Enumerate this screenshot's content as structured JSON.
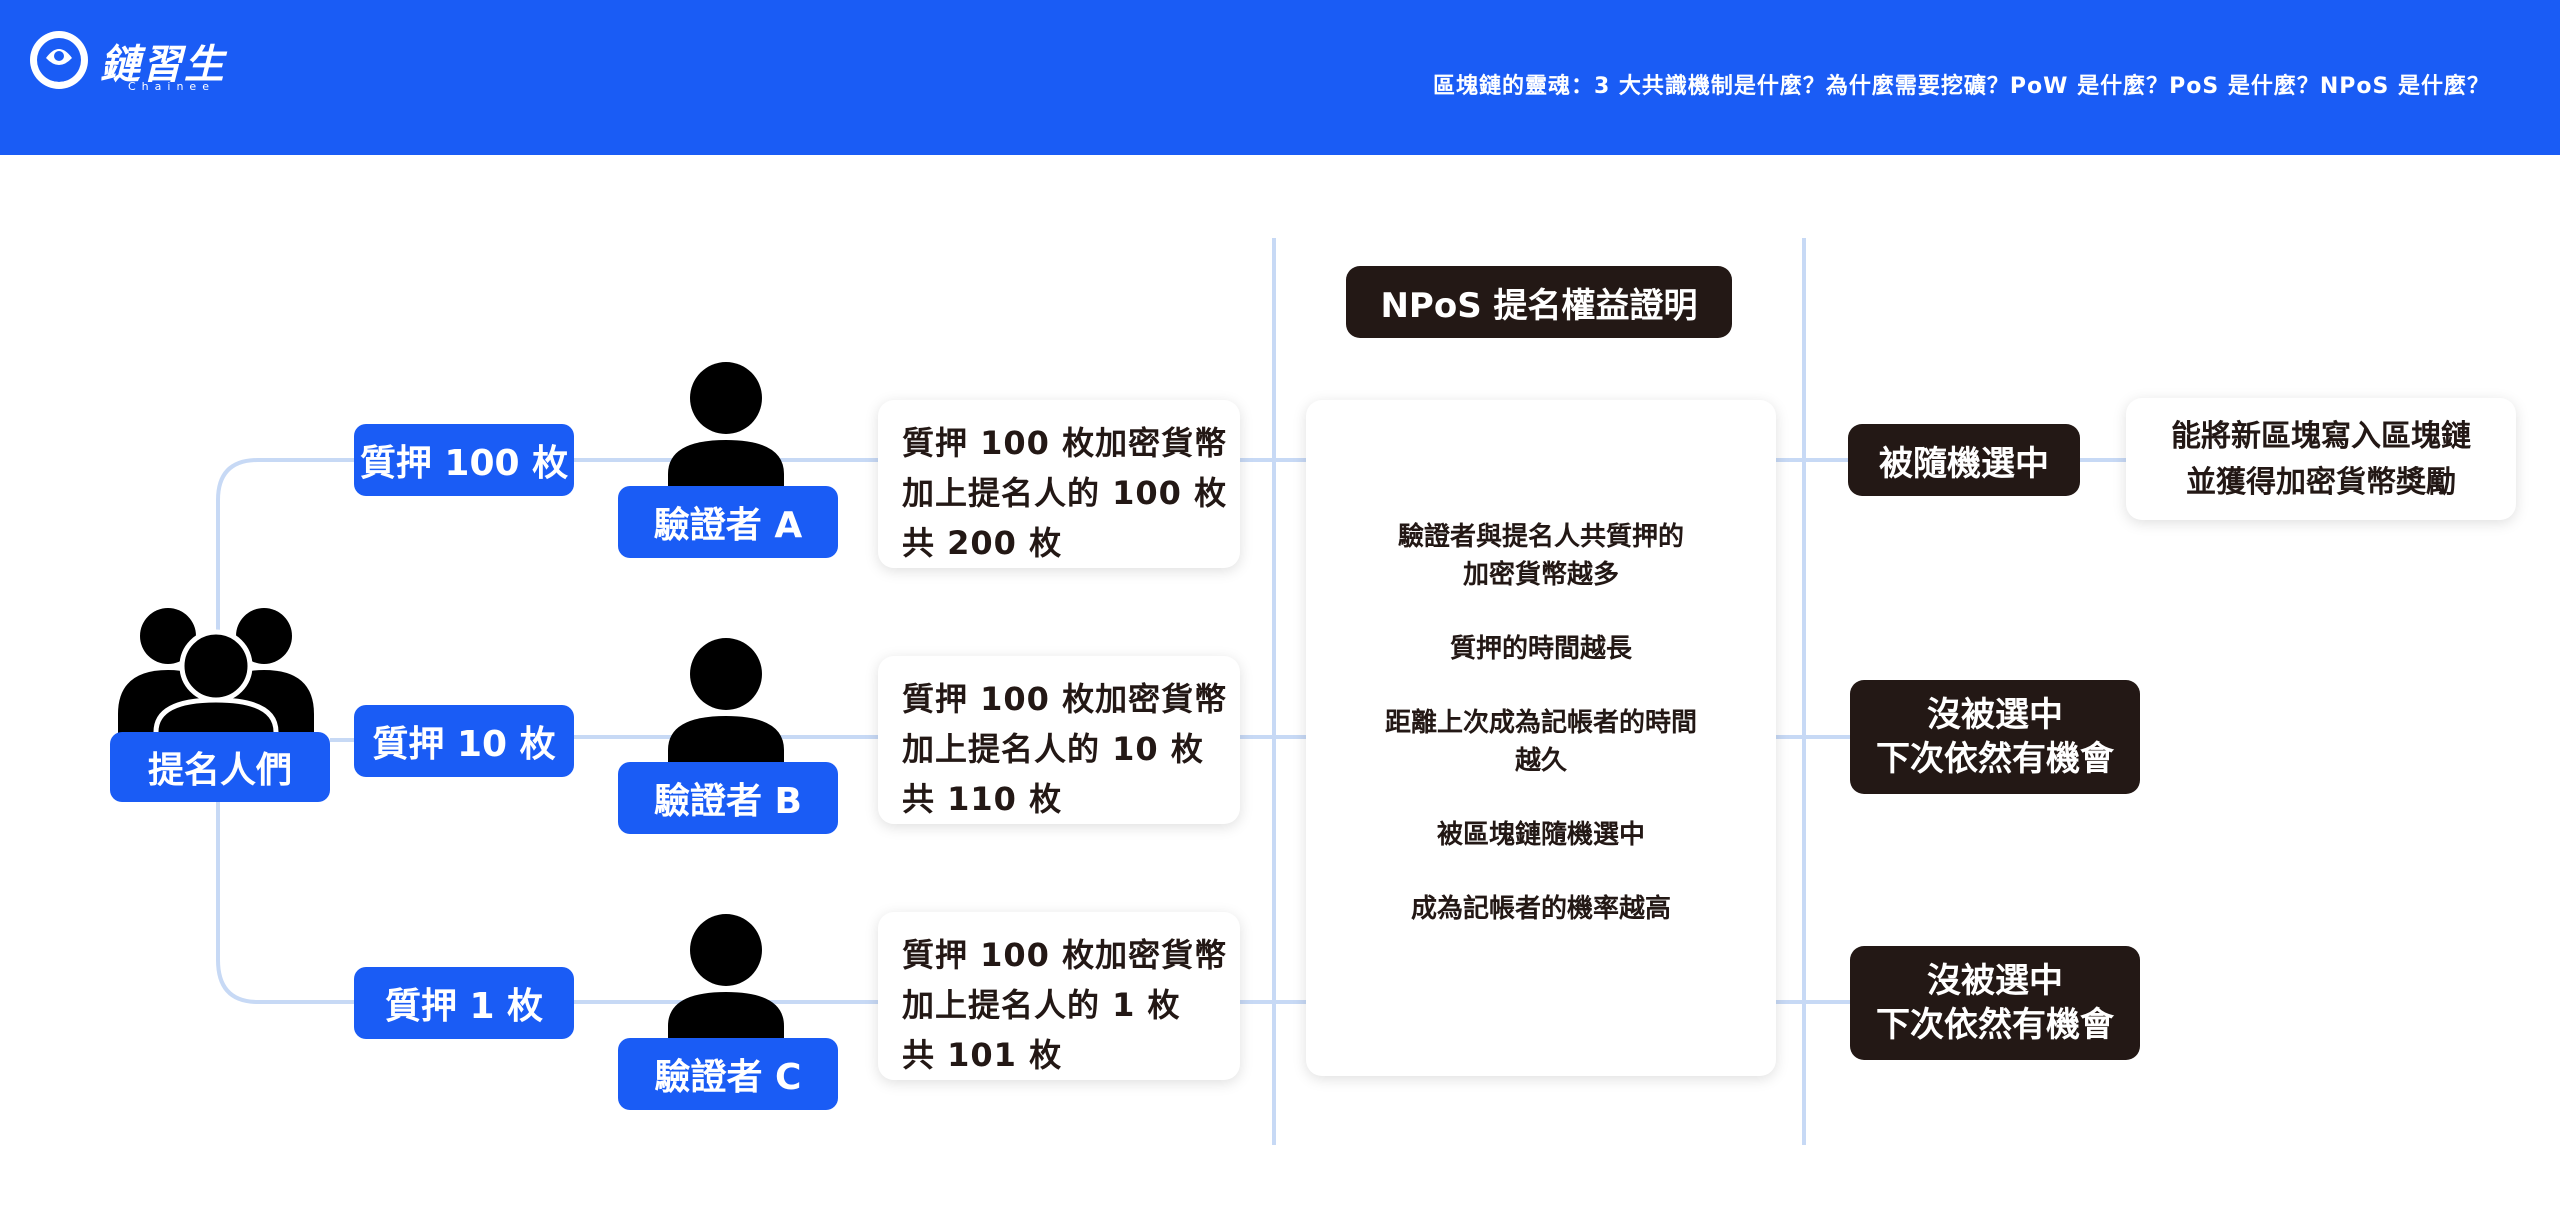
{
  "header": {
    "logo_text": "鏈習生",
    "logo_sub": "Chainee",
    "title": "區塊鏈的靈魂：3 大共識機制是什麼？為什麼需要挖礦？PoW 是什麼？PoS 是什麼？NPoS 是什麼？"
  },
  "nominators": {
    "label": "提名人們"
  },
  "stakes": [
    "質押 100 枚",
    "質押 10 枚",
    "質押 1 枚"
  ],
  "validators": [
    "驗證者 A",
    "驗證者 B",
    "驗證者 C"
  ],
  "cards": [
    [
      "質押 100 枚加密貨幣",
      "加上提名人的 100 枚",
      "共 200 枚"
    ],
    [
      "質押 100 枚加密貨幣",
      "加上提名人的 10 枚",
      "共 110 枚"
    ],
    [
      "質押 100 枚加密貨幣",
      "加上提名人的 1 枚",
      "共 101 枚"
    ]
  ],
  "center": {
    "title": "NPoS 提名權益證明",
    "items": [
      [
        "驗證者與提名人共質押的",
        "加密貨幣越多"
      ],
      [
        "質押的時間越長"
      ],
      [
        "距離上次成為記帳者的時間",
        "越久"
      ],
      [
        "被區塊鏈隨機選中"
      ],
      [
        "成為記帳者的機率越高"
      ]
    ]
  },
  "outcomes": {
    "selected": "被隨機選中",
    "selected_result": [
      "能將新區塊寫入區塊鏈",
      "並獲得加密貨幣獎勵"
    ],
    "not_selected_1": [
      "沒被選中",
      "下次依然有機會"
    ],
    "not_selected_2": [
      "沒被選中",
      "下次依然有機會"
    ]
  },
  "colors": {
    "brand_blue": "#1a5cf5",
    "dark": "#231815",
    "line": "#c7d9f5"
  }
}
